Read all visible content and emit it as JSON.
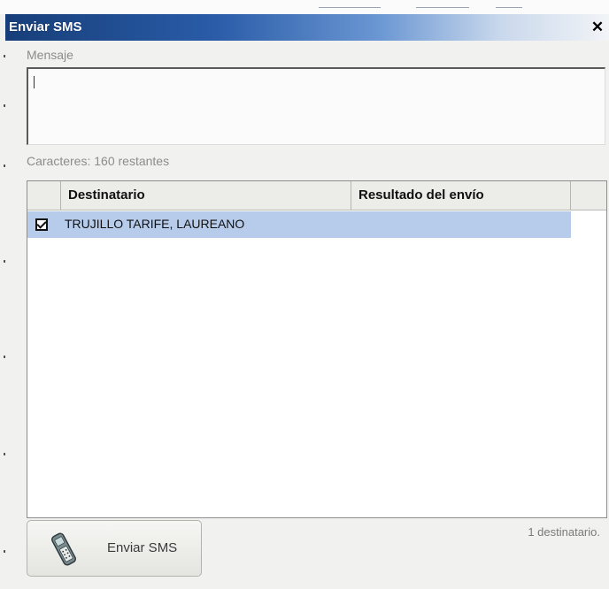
{
  "window": {
    "title": "Enviar SMS",
    "close_glyph": "✕"
  },
  "message": {
    "label": "Mensaje",
    "value": "",
    "chars_remaining": "Caracteres: 160 restantes"
  },
  "recipients_table": {
    "columns": [
      "",
      "Destinatario",
      "Resultado del envío",
      ""
    ],
    "rows": [
      {
        "checked": true,
        "name": "TRUJILLO TARIFE, LAUREANO",
        "result": ""
      }
    ]
  },
  "footer": {
    "recipient_count": "1 destinatario.",
    "send_button_label": "Enviar SMS",
    "send_button_icon": "mobile-phone-icon"
  },
  "colors": {
    "title_gradient_start": "#173e79",
    "selected_row": "#b6ccea",
    "window_bg": "#f1f1ef"
  }
}
